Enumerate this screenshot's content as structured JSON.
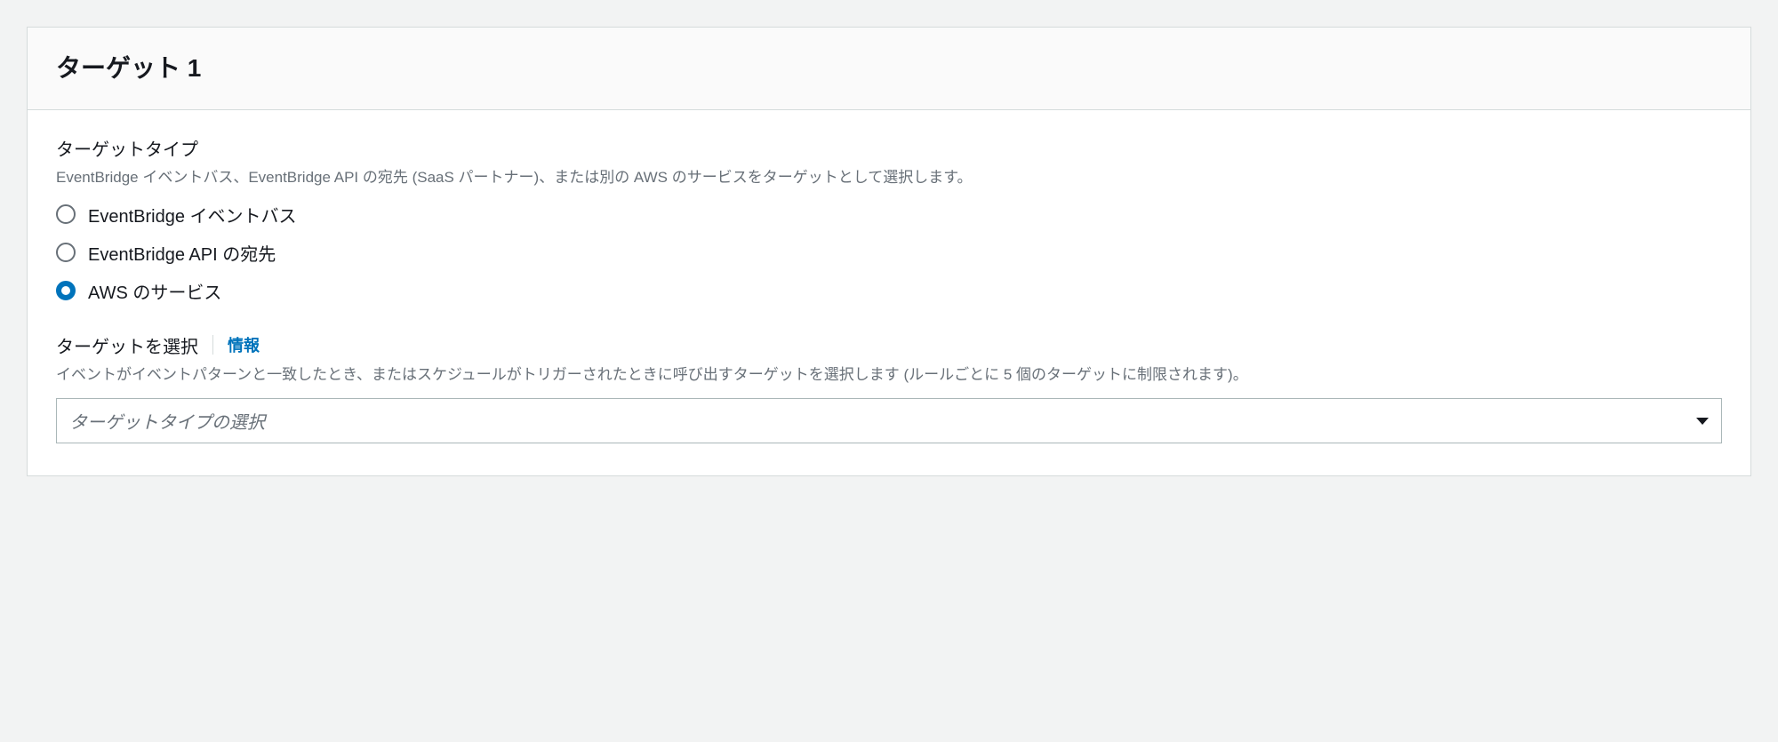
{
  "panel": {
    "title": "ターゲット 1"
  },
  "targetType": {
    "label": "ターゲットタイプ",
    "description": "EventBridge イベントバス、EventBridge API の宛先 (SaaS パートナー)、または別の AWS のサービスをターゲットとして選択します。",
    "options": [
      {
        "label": "EventBridge イベントバス",
        "selected": false
      },
      {
        "label": "EventBridge API の宛先",
        "selected": false
      },
      {
        "label": "AWS のサービス",
        "selected": true
      }
    ]
  },
  "selectTarget": {
    "label": "ターゲットを選択",
    "infoLink": "情報",
    "description": "イベントがイベントパターンと一致したとき、またはスケジュールがトリガーされたときに呼び出すターゲットを選択します (ルールごとに 5 個のターゲットに制限されます)。",
    "placeholder": "ターゲットタイプの選択"
  }
}
